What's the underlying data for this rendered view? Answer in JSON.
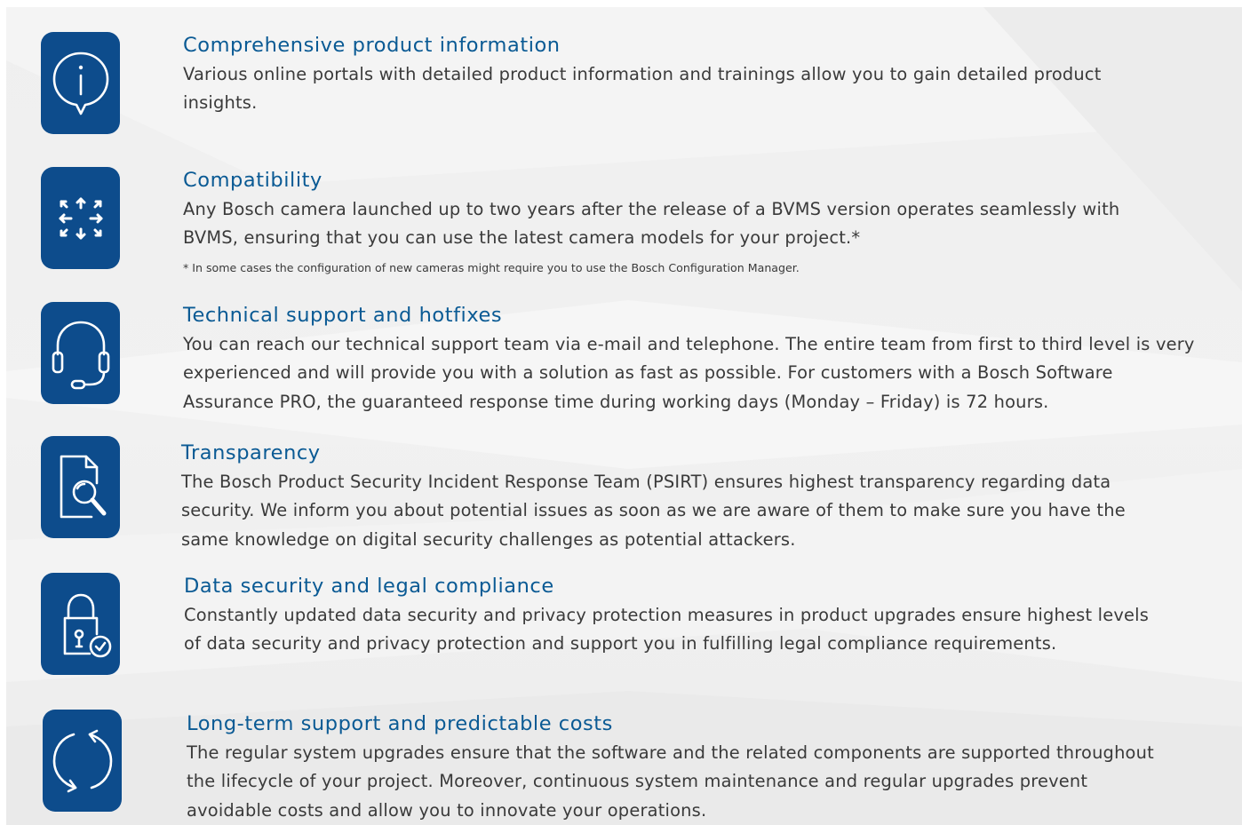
{
  "items": [
    {
      "icon": "info-speech-bubble-icon",
      "title": "Comprehensive product information",
      "text": "Various online portals with detailed product information and trainings allow you to gain detailed product insights."
    },
    {
      "icon": "compatibility-arrows-icon",
      "title": "Compatibility",
      "text": "Any Bosch camera launched up to two years after the release of a BVMS version operates seamlessly with BVMS, ensuring that you can use the latest camera models for your project.*",
      "note": "* In some cases the configuration of new cameras might require you to use the Bosch Configuration Manager."
    },
    {
      "icon": "headset-icon",
      "title": "Technical support and hotfixes",
      "text": "You can reach our technical support team via e-mail and telephone. The entire team from first to third level is very experienced and will provide you with a solution as fast as possible. For customers with a Bosch Software Assurance PRO, the guaranteed response time during working days (Monday – Friday) is 72 hours."
    },
    {
      "icon": "document-search-icon",
      "title": "Transparency",
      "text": "The Bosch Product Security Incident Response Team (PSIRT) ensures highest transparency regarding data security. We inform you about potential issues as soon as we are aware of them to make sure you have the same knowledge on digital security challenges as potential attackers."
    },
    {
      "icon": "padlock-check-icon",
      "title": "Data security and legal compliance",
      "text": "Constantly updated data security and privacy protection measures in product upgrades ensure highest levels of data security and privacy protection and support you in fulfilling legal compliance requirements."
    },
    {
      "icon": "refresh-cycle-icon",
      "title": "Long-term support and predictable costs",
      "text": "The regular system upgrades ensure that the software and the related components are supported throughout the lifecycle of your project. Moreover, continuous system maintenance and regular upgrades prevent avoidable costs and allow you to innovate your operations."
    }
  ],
  "colors": {
    "icon_background": "#0d4c8c",
    "heading": "#0a5a94",
    "body_text": "#3a3a3a",
    "page_background": "#efefef"
  }
}
